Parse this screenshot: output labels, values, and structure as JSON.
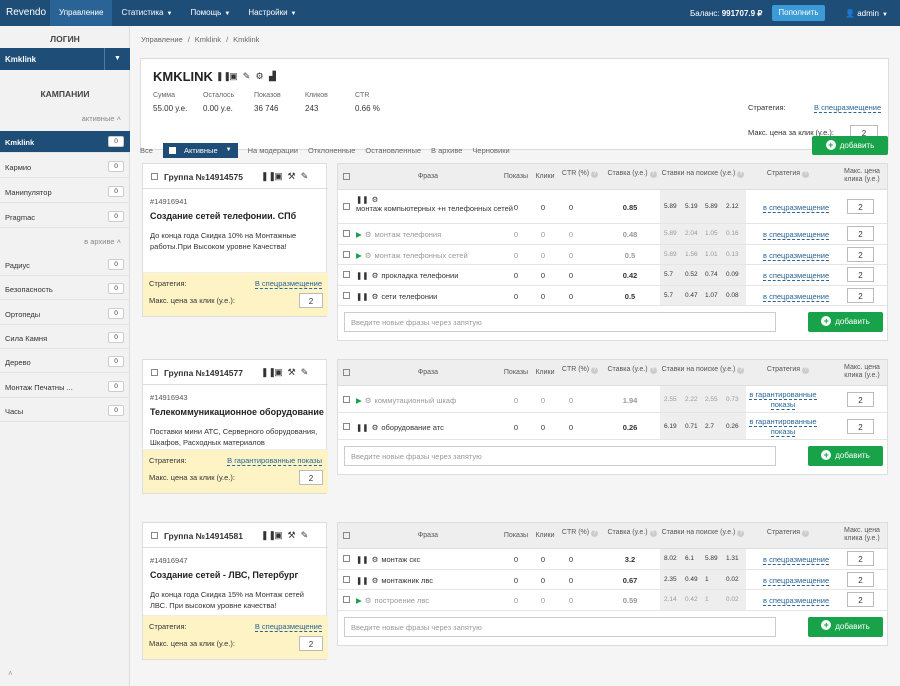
{
  "topbar": {
    "logo": "Revendo",
    "nav": [
      {
        "label": "Управление",
        "active": true
      },
      {
        "label": "Статистика"
      },
      {
        "label": "Помощь"
      },
      {
        "label": "Настройки"
      }
    ],
    "balance_label": "Баланс:",
    "balance_value": "991707.9 ₽",
    "topup": "Пополнить",
    "user": "admin"
  },
  "sidebar": {
    "login_title": "ЛОГИН",
    "login_value": "Kmklink",
    "campaigns_title": "КАМПАНИИ",
    "active_label": "активные",
    "archive_label": "в архиве",
    "active_items": [
      {
        "label": "Kmklink",
        "count": "0",
        "active": true
      },
      {
        "label": "Кармио",
        "count": "0"
      },
      {
        "label": "Манипулятор",
        "count": "0"
      },
      {
        "label": "Pragmac",
        "count": "0"
      }
    ],
    "archive_items": [
      {
        "label": "Радиус",
        "count": "0"
      },
      {
        "label": "Безопасность",
        "count": "0"
      },
      {
        "label": "Ортопеды",
        "count": "0"
      },
      {
        "label": "Сила Камня",
        "count": "0"
      },
      {
        "label": "Дерево",
        "count": "0"
      },
      {
        "label": "Монтаж Печатны ...",
        "count": "0"
      },
      {
        "label": "Часы",
        "count": "0"
      }
    ]
  },
  "breadcrumb": [
    "Управление",
    "/",
    "Kmklink",
    "/",
    "Kmklink"
  ],
  "campaign": {
    "title": "KMKLINK",
    "stats": [
      {
        "k": "Сумма",
        "v": "55.00 у.е."
      },
      {
        "k": "Осталось",
        "v": "0.00 у.е."
      },
      {
        "k": "Показов",
        "v": "36 746"
      },
      {
        "k": "Кликов",
        "v": "243"
      },
      {
        "k": "CTR",
        "v": "0.66 %"
      }
    ],
    "strategy_label": "Стратегия:",
    "strategy_value": "В спецразмещение",
    "maxprice_label": "Макс. цена за клик (у.е.):",
    "maxprice_value": "2"
  },
  "tabs": [
    "Все",
    "Активные",
    "На модерации",
    "Отклоненные",
    "Остановленные",
    "В архиве",
    "Черновики"
  ],
  "add_label": "добавить",
  "table_headers": {
    "phrase": "Фраза",
    "shows": "Показы",
    "clicks": "Клики",
    "ctr": "CTR (%)",
    "bid": "Ставка (у.е.)",
    "search_bids": "Ставки на поиске (у.е.)",
    "strategy": "Стратегия",
    "maxprice": "Макс. цена клика (у.е.)"
  },
  "new_phrase_placeholder": "Введите новые фразы через запятую",
  "groups": [
    {
      "name": "Группа №14914575",
      "id": "#14916941",
      "title": "Создание сетей телефонии. СПб",
      "desc": "До конца года Скидка 10% на Монтажные работы.При Высоком уровне Качества!",
      "strategy_label": "Стратегия:",
      "strategy_value": "В спецразмещение",
      "maxprice_label": "Макс. цена за клик (у.е.):",
      "maxprice_value": "2",
      "rows": [
        {
          "phrase": "монтаж компьютерных +н телефонных сетей",
          "shows": "0",
          "clicks": "0",
          "ctr": "0",
          "bid": "0.85",
          "bids": [
            "5.89",
            "5.19",
            "5.89",
            "2.12"
          ],
          "strategy": "в спецразмещение",
          "max": "2",
          "dim": false,
          "play": false
        },
        {
          "phrase": "монтаж телефония",
          "shows": "0",
          "clicks": "0",
          "ctr": "0",
          "bid": "0.48",
          "bids": [
            "5.89",
            "2.04",
            "1.05",
            "0.16"
          ],
          "strategy": "в спецразмещение",
          "max": "2",
          "dim": true,
          "play": true
        },
        {
          "phrase": "монтаж телефонных сетей",
          "shows": "0",
          "clicks": "0",
          "ctr": "0",
          "bid": "0.5",
          "bids": [
            "5.89",
            "1.56",
            "1.01",
            "0.13"
          ],
          "strategy": "в спецразмещение",
          "max": "2",
          "dim": true,
          "play": true
        },
        {
          "phrase": "прокладка телефонии",
          "shows": "0",
          "clicks": "0",
          "ctr": "0",
          "bid": "0.42",
          "bids": [
            "5.7",
            "0.52",
            "0.74",
            "0.09"
          ],
          "strategy": "в спецразмещение",
          "max": "2",
          "dim": false,
          "play": false
        },
        {
          "phrase": "сети телефонии",
          "shows": "0",
          "clicks": "0",
          "ctr": "0",
          "bid": "0.5",
          "bids": [
            "5.7",
            "0.47",
            "1.07",
            "0.08"
          ],
          "strategy": "в спецразмещение",
          "max": "2",
          "dim": false,
          "play": false
        }
      ]
    },
    {
      "name": "Группа №14914577",
      "id": "#14916943",
      "title": "Телекоммуникационное оборудование",
      "desc": "Поставки мини АТС, Серверного оборудования, Шкафов, Расходных материалов",
      "strategy_label": "Стратегия:",
      "strategy_value": "В гарантированные показы",
      "maxprice_label": "Макс. цена за клик (у.е.):",
      "maxprice_value": "2",
      "rows": [
        {
          "phrase": "коммутационный шкаф",
          "shows": "0",
          "clicks": "0",
          "ctr": "0",
          "bid": "1.94",
          "bids": [
            "2.55",
            "2.22",
            "2.55",
            "0.73"
          ],
          "strategy": "в гарантированные показы",
          "max": "2",
          "dim": true,
          "play": true
        },
        {
          "phrase": "оборудование атс",
          "shows": "0",
          "clicks": "0",
          "ctr": "0",
          "bid": "0.26",
          "bids": [
            "6.19",
            "0.71",
            "2.7",
            "0.26"
          ],
          "strategy": "в гарантированные показы",
          "max": "2",
          "dim": false,
          "play": false
        }
      ]
    },
    {
      "name": "Группа №14914581",
      "id": "#14916947",
      "title": "Создание сетей - ЛВС, Петербург",
      "desc": "До конца года Скидка 15% на Монтаж сетей ЛВС. При высоком уровне качества!",
      "strategy_label": "Стратегия:",
      "strategy_value": "В спецразмещение",
      "maxprice_label": "Макс. цена за клик (у.е.):",
      "maxprice_value": "2",
      "rows": [
        {
          "phrase": "монтаж скс",
          "shows": "0",
          "clicks": "0",
          "ctr": "0",
          "bid": "3.2",
          "bids": [
            "8.02",
            "6.1",
            "5.89",
            "1.31"
          ],
          "strategy": "в спецразмещение",
          "max": "2",
          "dim": false,
          "play": false
        },
        {
          "phrase": "монтажник лвс",
          "shows": "0",
          "clicks": "0",
          "ctr": "0",
          "bid": "0.67",
          "bids": [
            "2.35",
            "0.49",
            "1",
            "0.02"
          ],
          "strategy": "в спецразмещение",
          "max": "2",
          "dim": false,
          "play": false
        },
        {
          "phrase": "построение лвс",
          "shows": "0",
          "clicks": "0",
          "ctr": "0",
          "bid": "0.59",
          "bids": [
            "2.14",
            "0.42",
            "1",
            "0.02"
          ],
          "strategy": "в спецразмещение",
          "max": "2",
          "dim": true,
          "play": true
        }
      ]
    }
  ],
  "colors": {
    "topbar": "#1e4d78",
    "accent": "#3b9bd6",
    "add": "#18a34a",
    "group_footer": "#fdf3c4"
  }
}
